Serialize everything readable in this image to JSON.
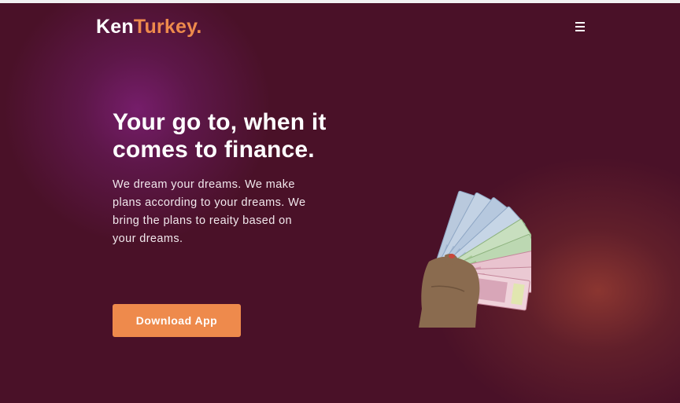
{
  "header": {
    "logo_part1": "Ken",
    "logo_part2": "Turkey",
    "logo_dot": ".",
    "menu_icon": "hamburger-menu-icon"
  },
  "hero": {
    "headline": "Your go to, when it comes to finance.",
    "subtext": "We dream your dreams. We make plans according to your dreams. We bring the plans to reaity based on your dreams.",
    "cta_label": "Download App"
  },
  "image": {
    "semantic": "hand-holding-banknotes"
  },
  "colors": {
    "background": "#4a1128",
    "accent": "#ee8a4c",
    "text": "#ffffff"
  }
}
